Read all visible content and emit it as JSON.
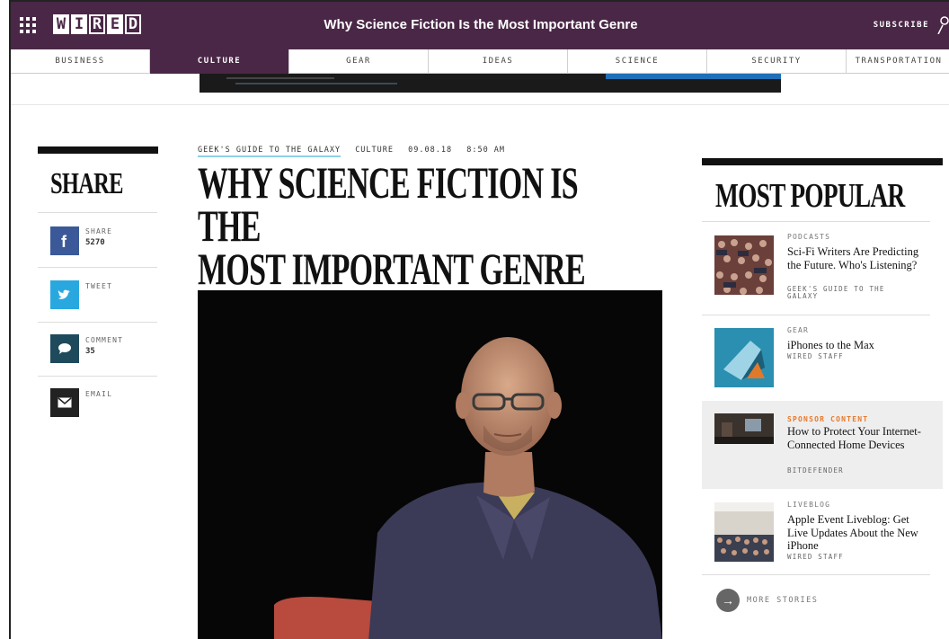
{
  "header": {
    "logo_letters": [
      "W",
      "I",
      "R",
      "E",
      "D"
    ],
    "title": "Why Science Fiction Is the Most Important Genre",
    "subscribe_label": "SUBSCRIBE",
    "bg_color": "#4a2746"
  },
  "nav": {
    "items": [
      {
        "label": "BUSINESS",
        "active": false
      },
      {
        "label": "CULTURE",
        "active": true
      },
      {
        "label": "GEAR",
        "active": false
      },
      {
        "label": "IDEAS",
        "active": false
      },
      {
        "label": "SCIENCE",
        "active": false
      },
      {
        "label": "SECURITY",
        "active": false
      },
      {
        "label": "TRANSPORTATION",
        "active": false
      }
    ]
  },
  "share": {
    "title": "SHARE",
    "buttons": [
      {
        "label": "SHARE",
        "count": "5270",
        "icon": "facebook-icon",
        "color": "#3b5998"
      },
      {
        "label": "TWEET",
        "count": "",
        "icon": "twitter-icon",
        "color": "#29a8e0"
      },
      {
        "label": "COMMENT",
        "count": "35",
        "icon": "comment-icon",
        "color": "#1f4a5c"
      },
      {
        "label": "EMAIL",
        "count": "",
        "icon": "email-icon",
        "color": "#222222"
      }
    ]
  },
  "article": {
    "category_link": "GEEK'S GUIDE TO THE GALAXY",
    "section": "CULTURE",
    "date": "09.08.18",
    "time": "8:50 AM",
    "headline_line1": "WHY SCIENCE FICTION IS THE",
    "headline_line2": "MOST IMPORTANT GENRE"
  },
  "most_popular": {
    "title": "MOST POPULAR",
    "items": [
      {
        "category": "PODCASTS",
        "headline": "Sci-Fi Writers Are Predicting the Future. Who's Listening?",
        "byline": "GEEK'S GUIDE TO THE GALAXY",
        "sponsored": false
      },
      {
        "category": "GEAR",
        "headline": "iPhones to the Max",
        "byline": "WIRED STAFF",
        "sponsored": false
      },
      {
        "category": "SPONSOR CONTENT",
        "headline": "How to Protect Your Internet-Connected Home Devices",
        "byline": "BITDEFENDER",
        "sponsored": true
      },
      {
        "category": "LIVEBLOG",
        "headline": "Apple Event Liveblog: Get Live Updates About the New iPhone",
        "byline": "WIRED STAFF",
        "sponsored": false
      }
    ],
    "more_label": "MORE STORIES"
  }
}
